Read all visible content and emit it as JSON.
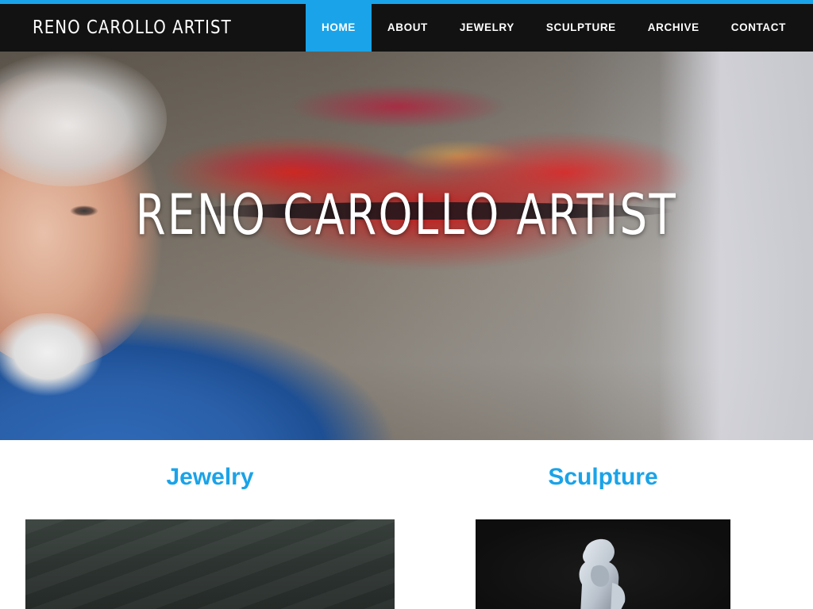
{
  "site": {
    "title": "RENO CAROLLO ARTIST",
    "accent_color": "#1aa3e8",
    "header_background": "#121212"
  },
  "nav": {
    "items": [
      {
        "label": "HOME",
        "active": true
      },
      {
        "label": "ABOUT",
        "active": false
      },
      {
        "label": "JEWELRY",
        "active": false
      },
      {
        "label": "SCULPTURE",
        "active": false
      },
      {
        "label": "ARCHIVE",
        "active": false
      },
      {
        "label": "CONTACT",
        "active": false
      }
    ]
  },
  "hero": {
    "title": "RENO CAROLLO ARTIST"
  },
  "sections": [
    {
      "heading": "Jewelry"
    },
    {
      "heading": "Sculpture"
    }
  ]
}
